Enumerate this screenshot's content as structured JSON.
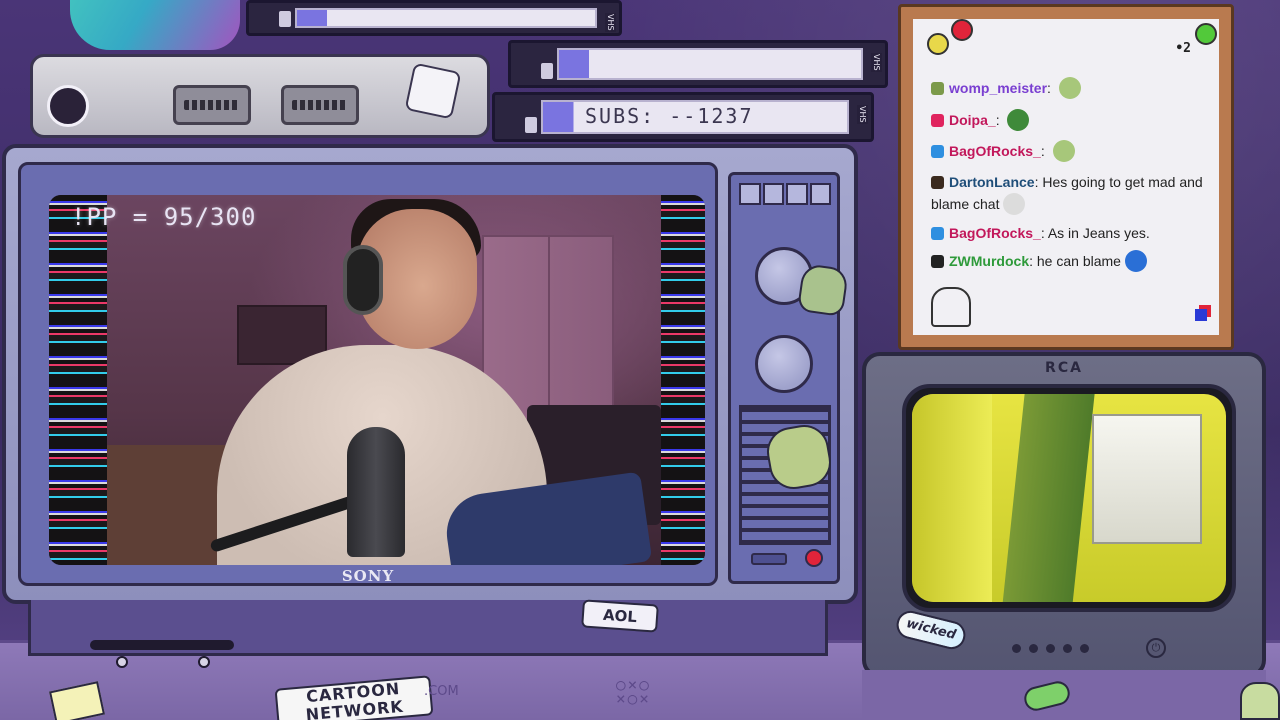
{
  "overlay": {
    "ipp_label": "!PP = 95/300",
    "subs_label": "SUBS: --1237",
    "vhs_tag": "VHS",
    "tv_brand": "SONY",
    "rca_brand": "RCA",
    "chat_corner_mark": "•2"
  },
  "chat": {
    "messages": [
      {
        "user": "womp_meister",
        "text": "",
        "color": "#7a3fd1",
        "badge_color": "#7c9a4a",
        "has_emote": true,
        "emote_color": "#a7c77a"
      },
      {
        "user": "Doipa_",
        "text": "",
        "color": "#c2185b",
        "badge_color": "#e0245e",
        "has_emote": true,
        "emote_color": "#3f8a3a"
      },
      {
        "user": "BagOfRocks_",
        "text": "",
        "color": "#c2185b",
        "badge_color": "#2e8fe0",
        "has_emote": true,
        "emote_color": "#a7c77a"
      },
      {
        "user": "DartonLance",
        "text": "Hes going to get mad and blame chat",
        "color": "#1f4e79",
        "badge_color": "#3b2a1e",
        "has_emote": true,
        "emote_color": "#dcdcdc"
      },
      {
        "user": "BagOfRocks_",
        "text": "As in Jeans yes.",
        "color": "#c2185b",
        "badge_color": "#2e8fe0",
        "has_emote": false,
        "emote_color": ""
      },
      {
        "user": "ZWMurdock",
        "text": "he can blame",
        "color": "#2e9a3a",
        "badge_color": "#222222",
        "has_emote": true,
        "emote_color": "#2a6fd6"
      }
    ]
  },
  "stickers": {
    "aol": "AOL",
    "cartoon_network": "CARTOON NETWORK",
    "cartoon_com": ".COM",
    "wicked": "wicked"
  },
  "colors": {
    "accent": "#6a6db0",
    "tv_body": "#a6a8cf",
    "chat_bg": "#f1f0f4",
    "cork": "#b97a4f",
    "led_red": "#e0243a"
  }
}
